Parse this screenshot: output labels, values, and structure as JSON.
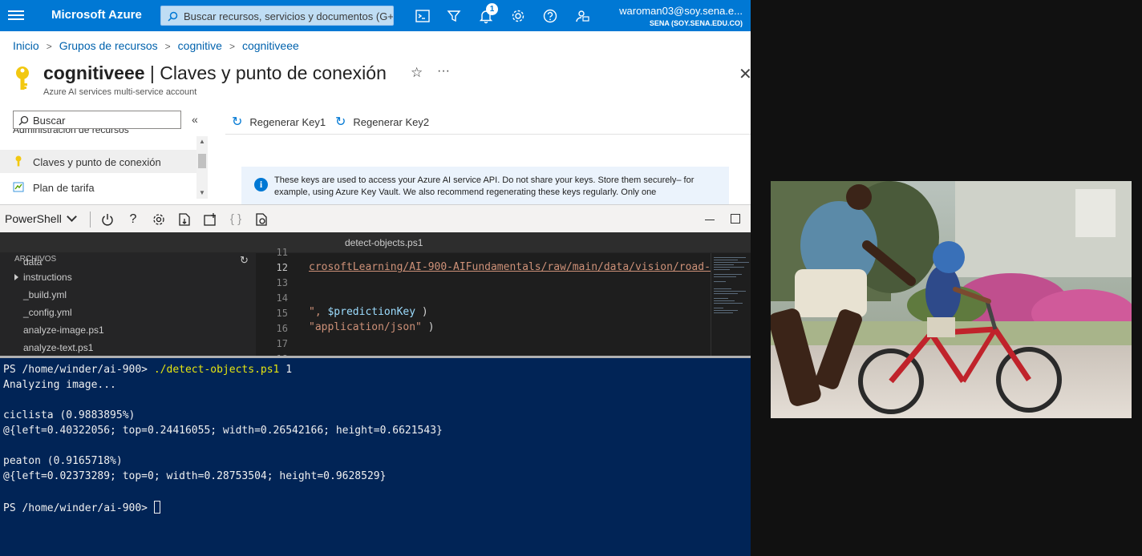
{
  "topbar": {
    "brand": "Microsoft Azure",
    "search_placeholder": "Buscar recursos, servicios y documentos (G+",
    "notification_count": "1",
    "user_email": "waroman03@soy.sena.e...",
    "user_org": "SENA (SOY.SENA.EDU.CO)",
    "accent_color": "#0078d4"
  },
  "breadcrumb": [
    "Inicio",
    "Grupos de recursos",
    "cognitive",
    "cognitiveee"
  ],
  "page": {
    "title_bold": "cognitiveee",
    "title_rest": " | Claves y punto de conexión",
    "subtitle": "Azure AI services multi-service account"
  },
  "nav": {
    "search_placeholder": "Buscar",
    "section": "Administración de recursos",
    "items": [
      "Claves y punto de conexión",
      "Plan de tarifa"
    ]
  },
  "commands": {
    "regen1": "Regenerar Key1",
    "regen2": "Regenerar Key2"
  },
  "info": {
    "text": "These keys are used to access your Azure AI service API. Do not share your keys. Store them securely– for example, using Azure Key Vault. We also recommend regenerating these keys regularly. Only one"
  },
  "shell": {
    "selector": "PowerShell"
  },
  "editor": {
    "tab": "detect-objects.ps1",
    "explorer_header": "ARCHIVOS",
    "files": [
      "data",
      "instructions",
      "_build.yml",
      "_config.yml",
      "analyze-image.ps1",
      "analyze-text.ps1"
    ],
    "line_numbers": [
      "11",
      "12",
      "13",
      "14",
      "15",
      "16",
      "17",
      "18"
    ],
    "line12": "crosoftLearning/AI-900-AIFundamentals/raw/main/data/vision/road-s",
    "line15_a": "\", ",
    "line15_var": "$predictionKey",
    "line15_b": " )",
    "line16_str": "\"application/json\"",
    "line16_b": " )"
  },
  "terminal": {
    "prompt": "PS /home/winder/ai-900> ",
    "command": "./detect-objects.ps1",
    "arg": " 1",
    "analyzing": "Analyzing image...",
    "obj1_label": "ciclista (0.9883895%)",
    "obj1_box": "@{left=0.40322056; top=0.24416055; width=0.26542166; height=0.6621543}",
    "obj2_label": "peaton (0.9165718%)",
    "obj2_box": "@{left=0.02373289; top=0; width=0.28753504; height=0.9628529}",
    "final_prompt": "PS /home/winder/ai-900> "
  }
}
